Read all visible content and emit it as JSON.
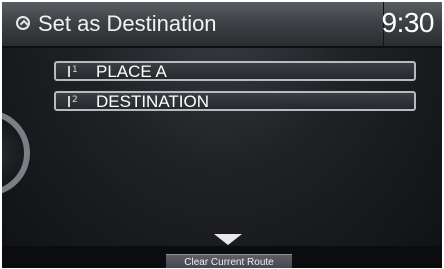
{
  "header": {
    "title": "Set as Destination",
    "time": "9:30",
    "back_icon": "back-circle-icon"
  },
  "list": {
    "items": [
      {
        "index": "1",
        "label": "PLACE A",
        "icon": "waypoint-flag-icon"
      },
      {
        "index": "2",
        "label": "DESTINATION",
        "icon": "waypoint-flag-icon"
      }
    ]
  },
  "footer": {
    "more_icon": "chevron-down-icon",
    "clear_route_label": "Clear Current Route"
  },
  "colors": {
    "text": "#ffffff",
    "item_border": "#b7bbc0",
    "background": "#1f2125"
  }
}
